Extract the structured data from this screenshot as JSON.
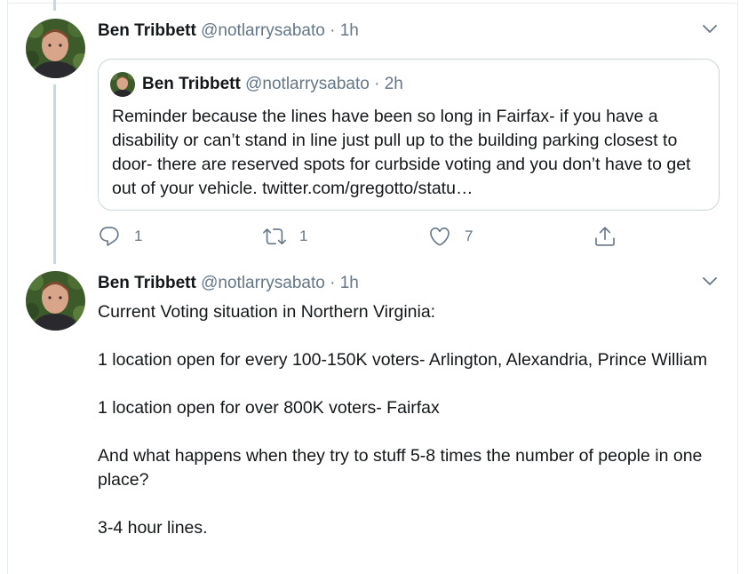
{
  "tweet1": {
    "author_name": "Ben Tribbett",
    "handle": "@notlarrysabato",
    "separator": "·",
    "time": "1h",
    "quoted": {
      "author_name": "Ben Tribbett",
      "handle": "@notlarrysabato",
      "separator": "·",
      "time": "2h",
      "text": "Reminder because the lines have been so long in Fairfax- if you have a disability or can’t stand in line just pull up to the building parking closest to door- there are reserved spots for curbside voting and you don’t have to get out of your vehicle. twitter.com/gregotto/statu…"
    },
    "actions": {
      "reply_count": "1",
      "retweet_count": "1",
      "like_count": "7"
    }
  },
  "tweet2": {
    "author_name": "Ben Tribbett",
    "handle": "@notlarrysabato",
    "separator": "·",
    "time": "1h",
    "paragraphs": [
      "Current Voting situation in Northern Virginia:",
      "1 location open for every 100-150K voters- Arlington, Alexandria, Prince William",
      "1 location open for over 800K voters- Fairfax",
      "And what happens when they try to stuff 5-8 times the number of people in one place?",
      "3-4 hour lines."
    ]
  },
  "icons": {
    "reply": "reply-icon",
    "retweet": "retweet-icon",
    "like": "like-icon",
    "share": "share-icon",
    "more": "chevron-down-icon"
  },
  "colors": {
    "text": "#14171a",
    "secondary": "#657786",
    "border": "#ccd6dd"
  }
}
